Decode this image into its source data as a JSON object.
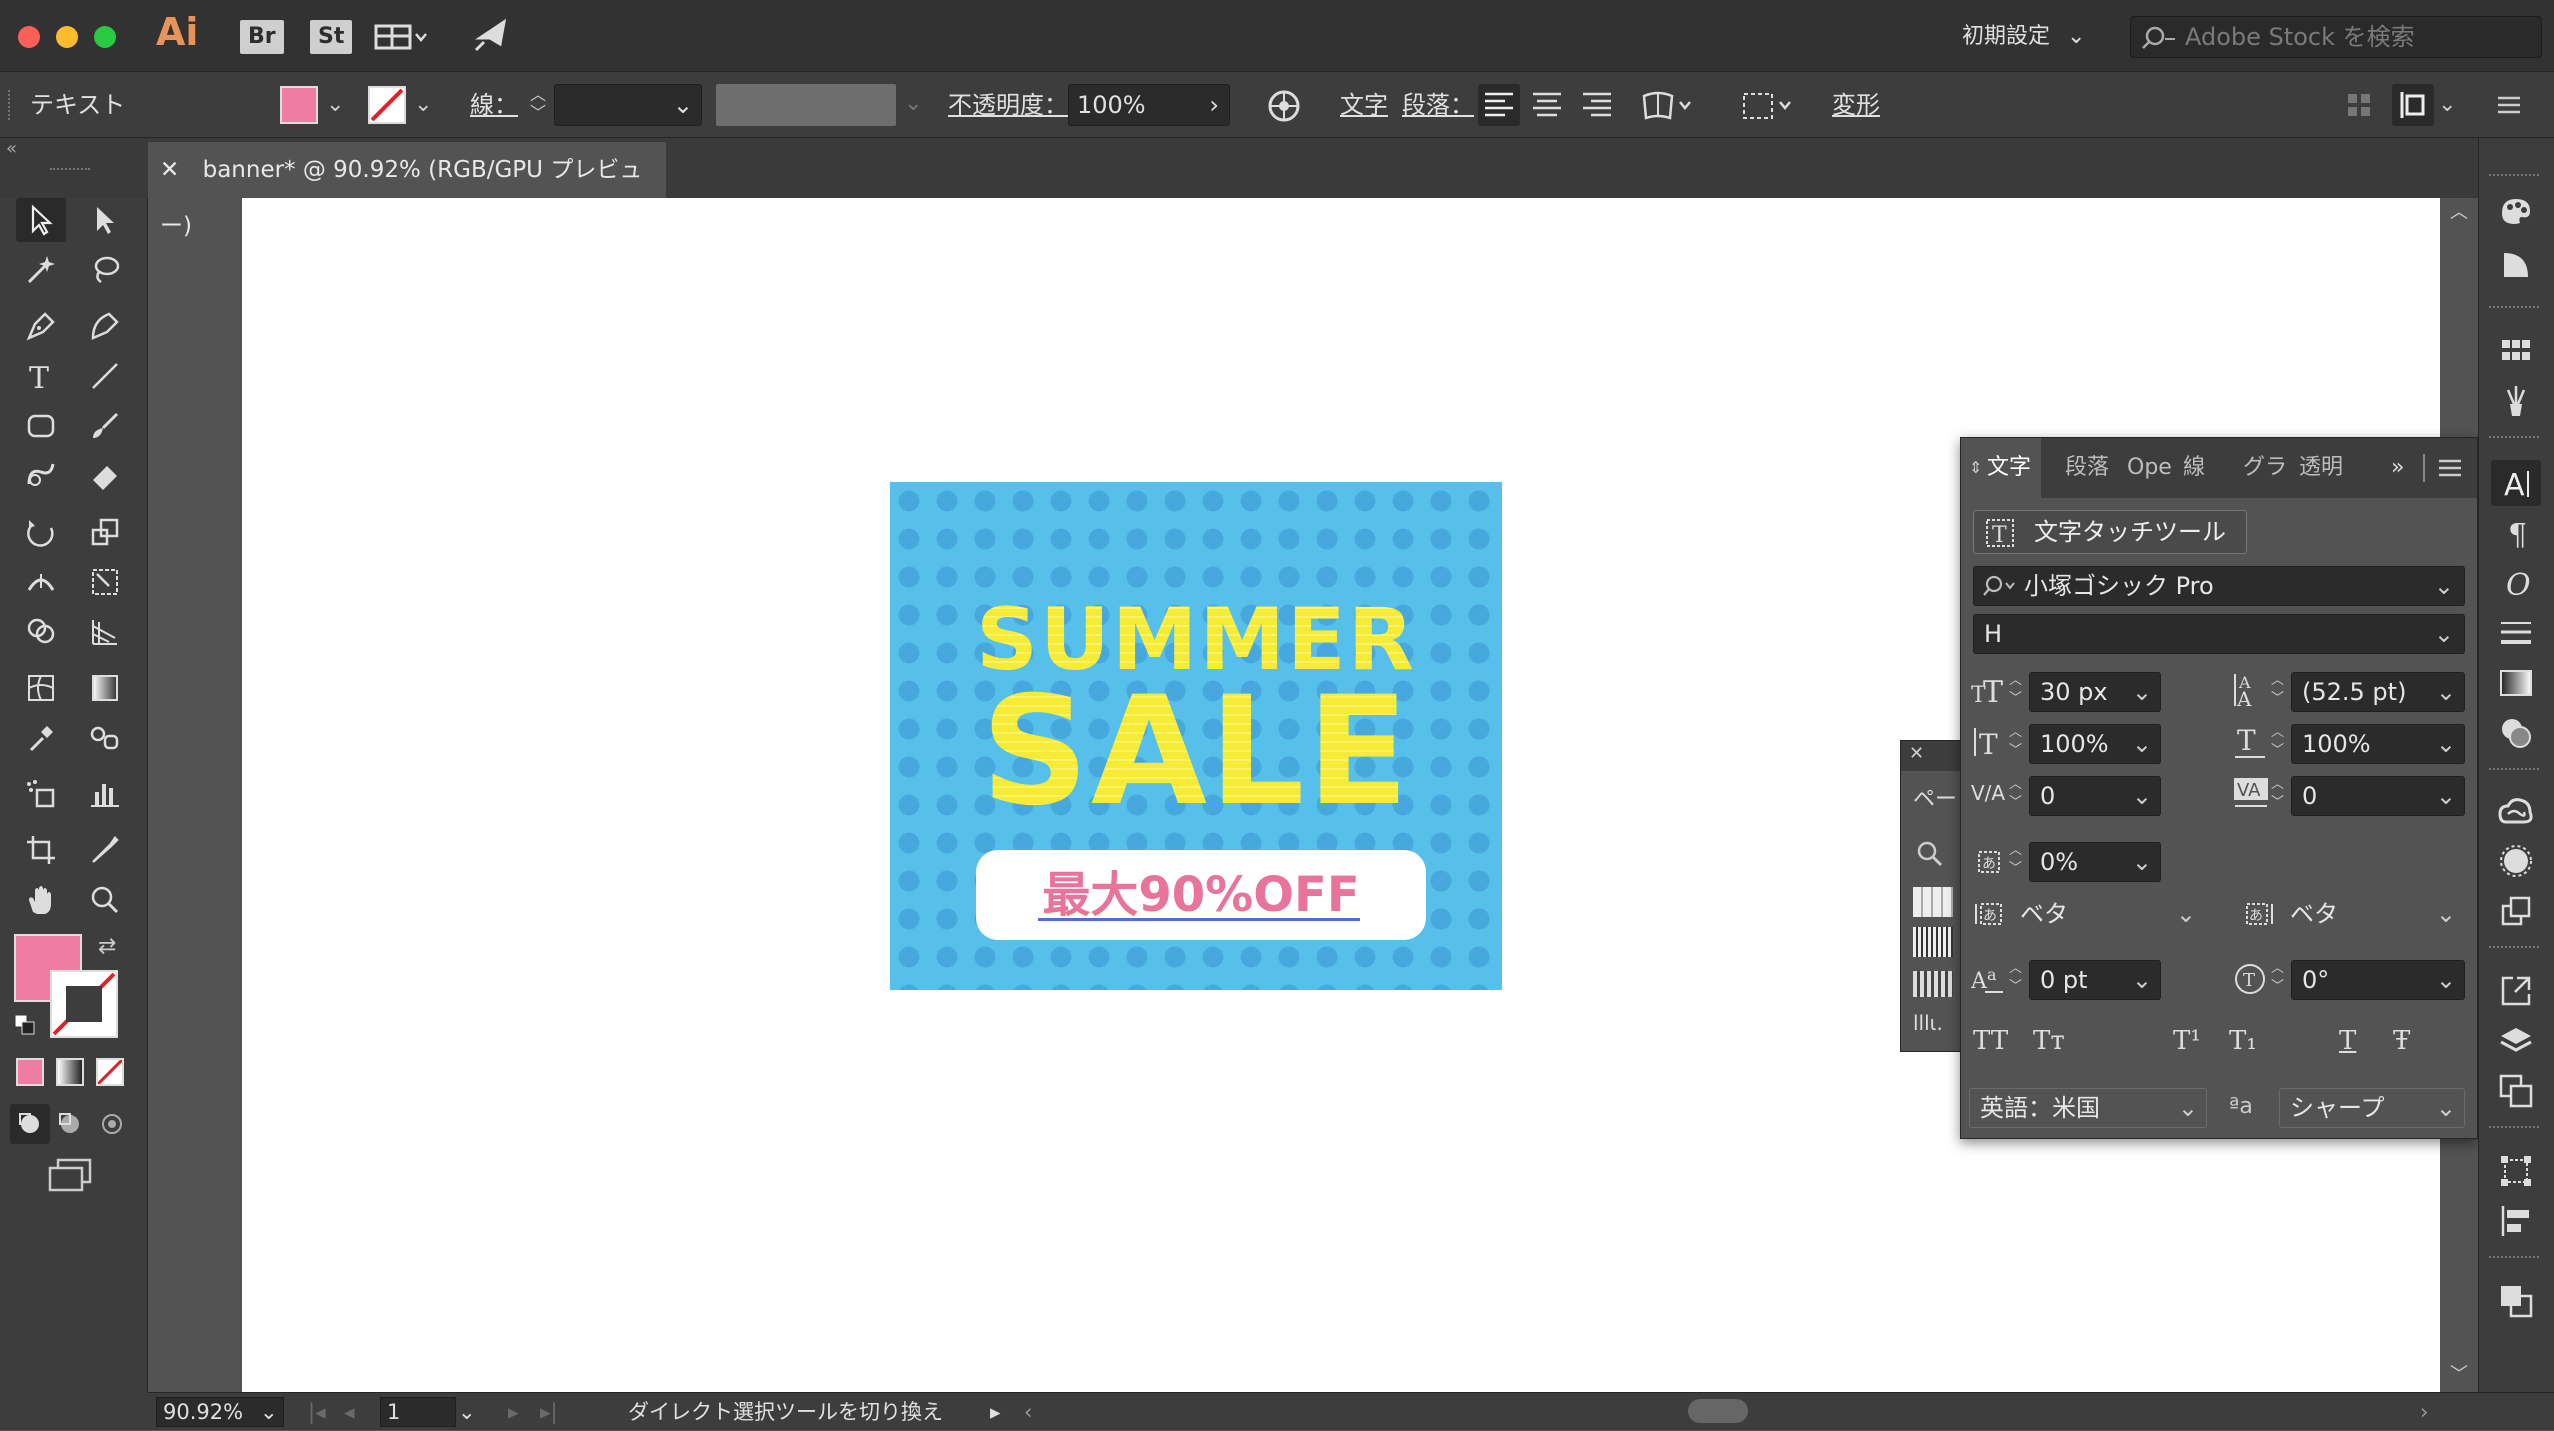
{
  "app": {
    "logo": "Ai",
    "badges": [
      "Br",
      "St"
    ],
    "workspace": "初期設定",
    "search_placeholder": "Adobe Stock を検索"
  },
  "control_bar": {
    "mode_label": "テキスト",
    "fill_color": "#ef7ca2",
    "stroke_label": "線：",
    "opacity_label": "不透明度：",
    "opacity_value": "100%",
    "char_label": "文字",
    "para_label": "段落：",
    "transform_label": "変形"
  },
  "document": {
    "tab_title": "banner* @ 90.92% (RGB/GPU プレビュー)"
  },
  "banner": {
    "line1": "SUMMER",
    "line2": "SALE",
    "button_text": "最大90%OFF",
    "bg_color": "#56c0ea",
    "dot_color": "#47a8de",
    "text_color": "#f7ec35",
    "button_text_color": "#e8739b"
  },
  "character_panel": {
    "tabs": [
      "文字",
      "段落",
      "Ope",
      "線",
      "グラ",
      "透明"
    ],
    "touch_tool_label": "文字タッチツール",
    "font_family": "小塚ゴシック Pro",
    "font_style": "H",
    "font_size": "30 px",
    "leading": "(52.5 pt)",
    "vertical_scale": "100%",
    "horizontal_scale": "100%",
    "kerning": "0",
    "tracking": "0",
    "tsume": "0%",
    "aki_left": "ベタ",
    "aki_right": "ベタ",
    "baseline_shift": "0 pt",
    "rotation": "0°",
    "caps_buttons": [
      "TT",
      "Tт",
      "T¹",
      "T₁",
      "T",
      "Ŧ"
    ],
    "language": "英語：米国",
    "antialias": "シャープ"
  },
  "mini_panel": {
    "label": "ペー"
  },
  "status_bar": {
    "zoom": "90.92%",
    "artboard_number": "1",
    "status_text": "ダイレクト選択ツールを切り換え"
  }
}
